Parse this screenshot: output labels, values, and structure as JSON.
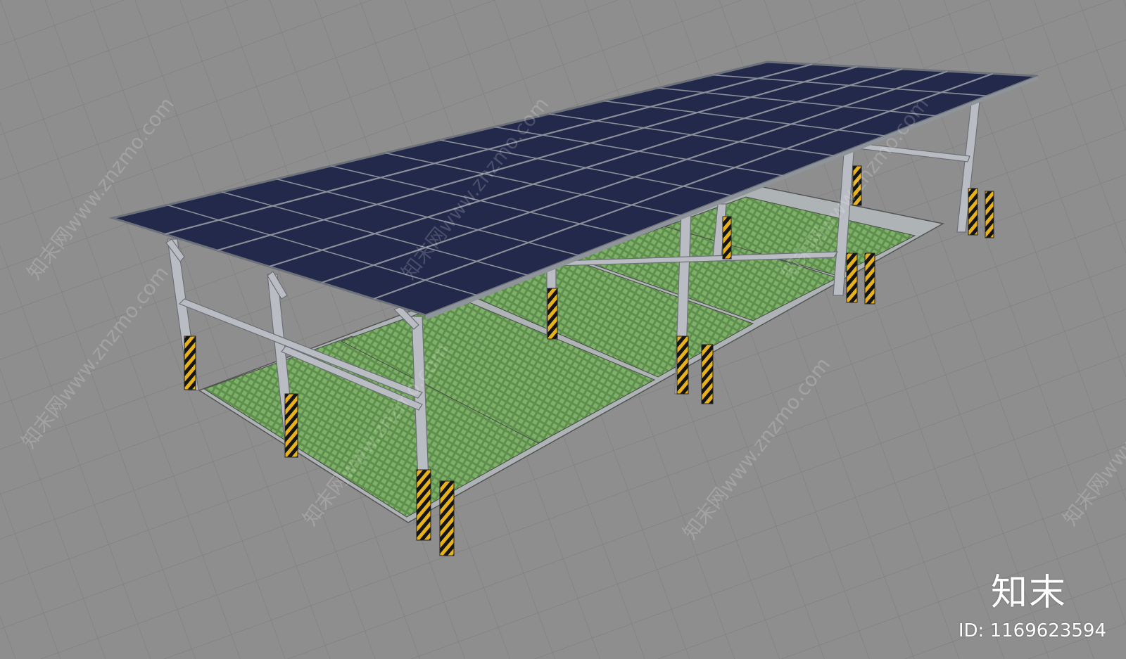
{
  "watermark": {
    "brand": "知末",
    "id_label": "ID: 1169623594",
    "diagonal_text": "知末网www.znzmo.com"
  },
  "scene": {
    "subject": "solar-carport",
    "colors": {
      "background": "#8d8d8d",
      "panel": "#22294a",
      "frame": "#b9bcc2",
      "green_paver": "#6b9a58",
      "hazard_yellow": "#e8b21a",
      "hazard_black": "#141414"
    }
  }
}
